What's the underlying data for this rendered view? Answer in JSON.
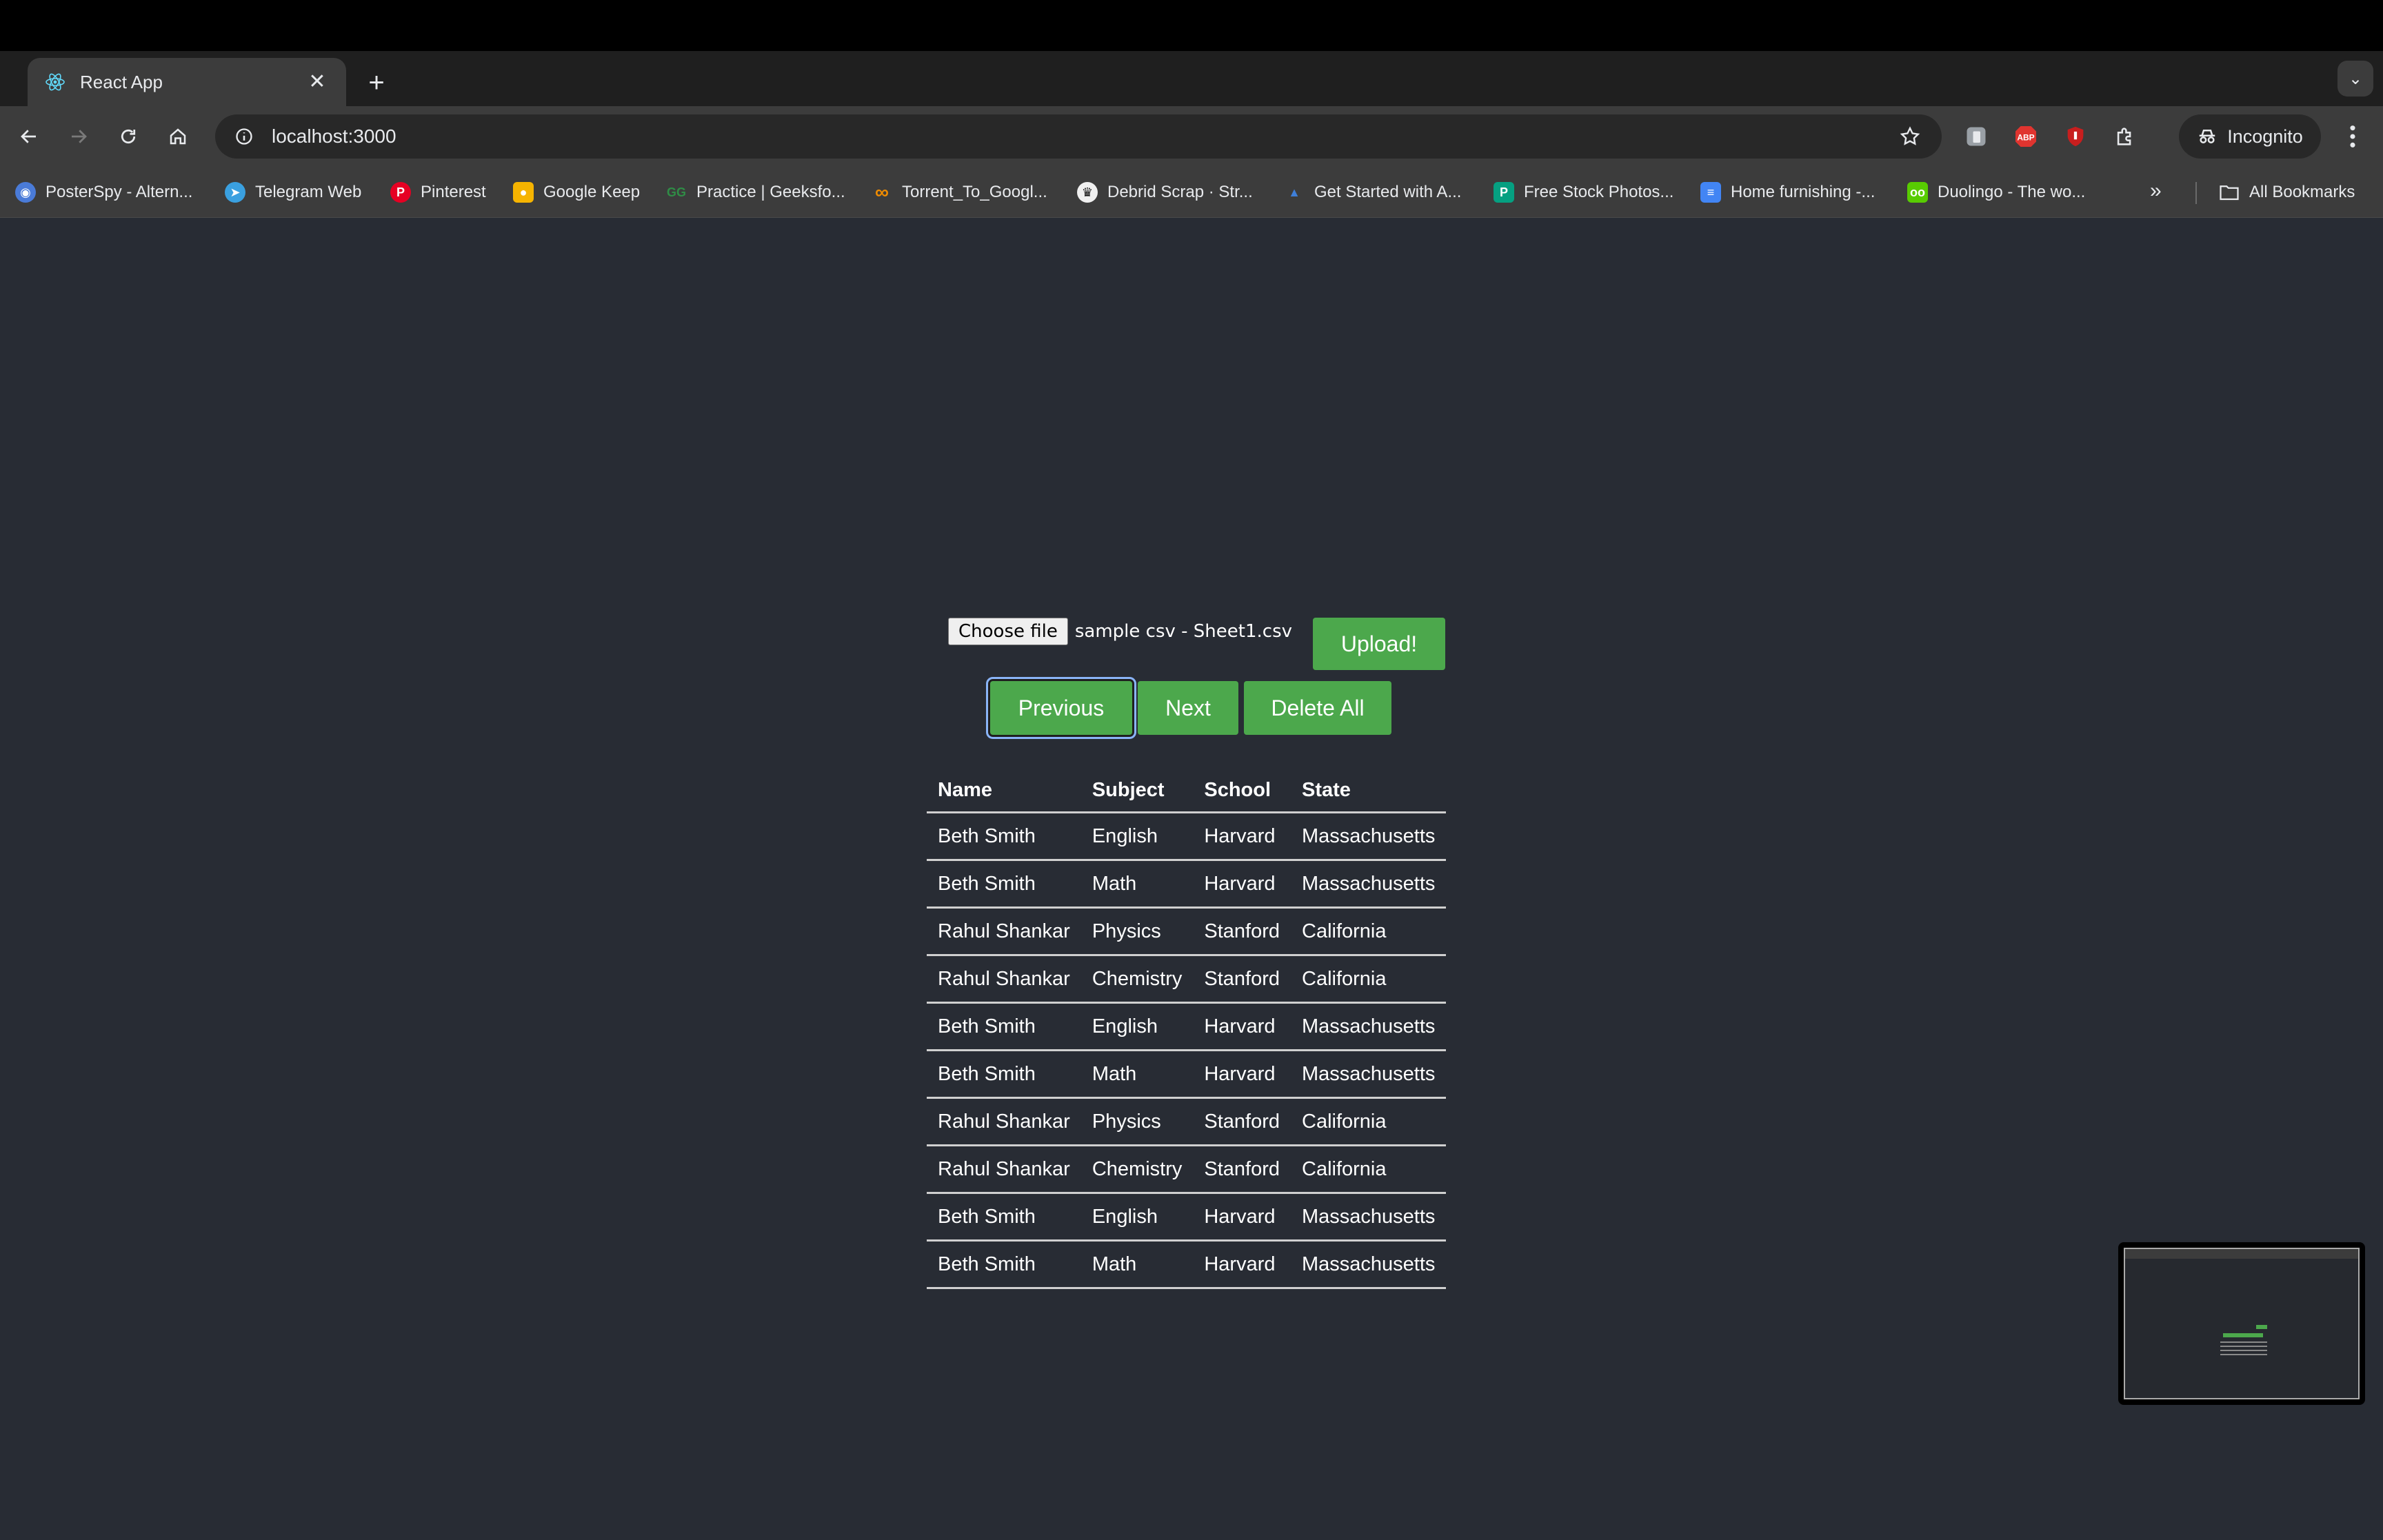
{
  "browser": {
    "tab_title": "React App",
    "url": "localhost:3000",
    "incognito_label": "Incognito"
  },
  "bookmarks": [
    {
      "label": "PosterSpy - Altern...",
      "icon": "posterspy-icon",
      "color": "#4a7bd8"
    },
    {
      "label": "Telegram Web",
      "icon": "telegram-icon",
      "color": "#3aa0e0"
    },
    {
      "label": "Pinterest",
      "icon": "pinterest-icon",
      "color": "#e60023"
    },
    {
      "label": "Google Keep",
      "icon": "google-keep-icon",
      "color": "#f6b400"
    },
    {
      "label": "Practice | Geeksfo...",
      "icon": "geeksforgeeks-icon",
      "color": "#2f8d46"
    },
    {
      "label": "Torrent_To_Googl...",
      "icon": "infinity-icon",
      "color": "#f08c00"
    },
    {
      "label": "Debrid Scrap · Str...",
      "icon": "crown-icon",
      "color": "#111111"
    },
    {
      "label": "Get Started with A...",
      "icon": "arch-icon",
      "color": "#3f7fd8"
    },
    {
      "label": "Free Stock Photos...",
      "icon": "pexels-icon",
      "color": "#05a081"
    },
    {
      "label": "Home furnishing -...",
      "icon": "docs-icon",
      "color": "#4285f4"
    },
    {
      "label": "Duolingo - The wo...",
      "icon": "duolingo-icon",
      "color": "#58cc02"
    }
  ],
  "all_bookmarks_label": "All Bookmarks",
  "uploader": {
    "choose_label": "Choose file",
    "file_name": "sample csv - Sheet1.csv",
    "upload_label": "Upload!"
  },
  "controls": {
    "previous_label": "Previous",
    "next_label": "Next",
    "delete_label": "Delete All"
  },
  "table": {
    "headers": [
      "Name",
      "Subject",
      "School",
      "State"
    ],
    "rows": [
      [
        "Beth Smith",
        "English",
        "Harvard",
        "Massachusetts"
      ],
      [
        "Beth Smith",
        "Math",
        "Harvard",
        "Massachusetts"
      ],
      [
        "Rahul Shankar",
        "Physics",
        "Stanford",
        "California"
      ],
      [
        "Rahul Shankar",
        "Chemistry",
        "Stanford",
        "California"
      ],
      [
        "Beth Smith",
        "English",
        "Harvard",
        "Massachusetts"
      ],
      [
        "Beth Smith",
        "Math",
        "Harvard",
        "Massachusetts"
      ],
      [
        "Rahul Shankar",
        "Physics",
        "Stanford",
        "California"
      ],
      [
        "Rahul Shankar",
        "Chemistry",
        "Stanford",
        "California"
      ],
      [
        "Beth Smith",
        "English",
        "Harvard",
        "Massachusetts"
      ],
      [
        "Beth Smith",
        "Math",
        "Harvard",
        "Massachusetts"
      ]
    ]
  },
  "colors": {
    "page_bg": "#282c34",
    "button_green": "#4ca84c",
    "focus_ring": "#8ab4f8"
  }
}
